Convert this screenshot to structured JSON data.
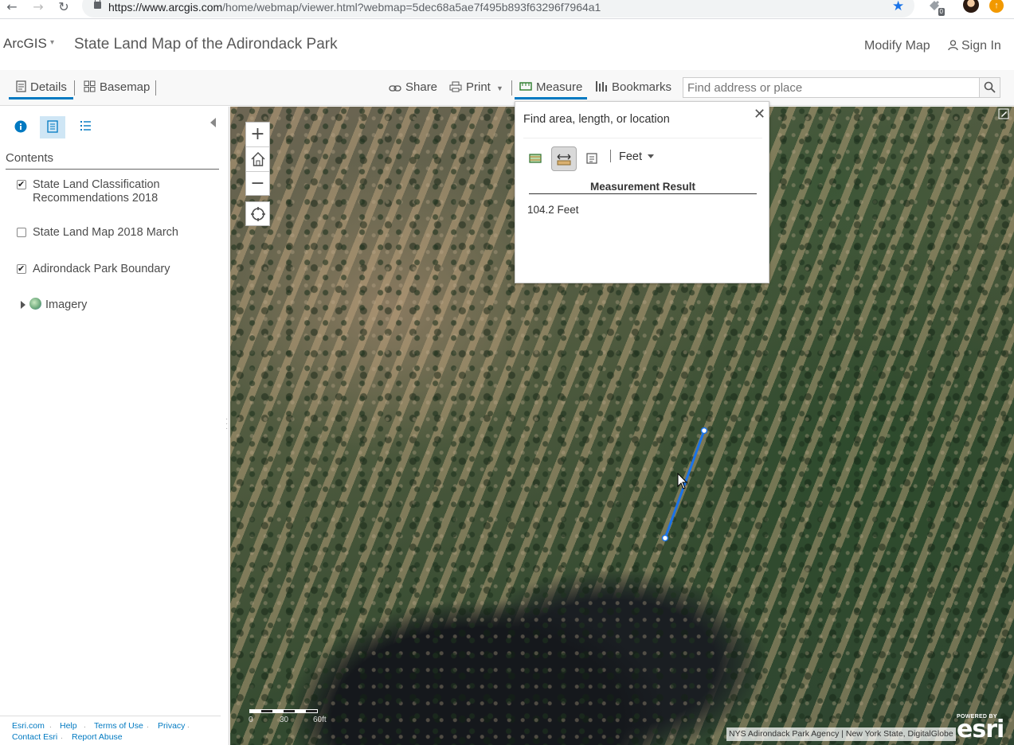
{
  "browser": {
    "url_main": "https://www.arcgis.com",
    "url_rest": "/home/webmap/viewer.html?webmap=5dec68a5ae7f495b893f63296f7964a1",
    "back_icon": "←",
    "forward_icon": "→",
    "reload_icon": "↻",
    "star_icon": "★",
    "extension_badge": "0",
    "update_icon": "↑"
  },
  "header": {
    "brand": "ArcGIS",
    "brand_caret": "▾",
    "title": "State Land Map of the Adirondack Park",
    "modify_map": "Modify Map",
    "sign_in": "Sign In"
  },
  "toolbar": {
    "details": "Details",
    "basemap": "Basemap",
    "share": "Share",
    "print": "Print",
    "measure": "Measure",
    "bookmarks": "Bookmarks",
    "search_placeholder": "Find address or place",
    "accent": "#0079c1"
  },
  "panel": {
    "contents_label": "Contents",
    "layers": [
      {
        "label": "State Land Classification Recommendations 2018",
        "checked": true
      },
      {
        "label": "State Land Map 2018 March",
        "checked": false
      },
      {
        "label": "Adirondack Park Boundary",
        "checked": true
      }
    ],
    "group_layer": "Imagery",
    "footer_links": [
      "Esri.com",
      "Help",
      "Terms of Use",
      "Privacy",
      "Contact Esri",
      "Report Abuse"
    ]
  },
  "map": {
    "zoom_in": "+",
    "zoom_out": "−",
    "scale_labels": [
      "0",
      "30",
      "60ft"
    ],
    "attribution": "NYS Adirondack Park Agency | New York State, DigitalGlobe",
    "logo_powered": "POWERED BY",
    "logo_word": "esri",
    "measure_line_color": "#1a73e8"
  },
  "measure": {
    "title": "Find area, length, or location",
    "close": "✕",
    "unit": "Feet",
    "result_header": "Measurement Result",
    "result_value": "104.2 Feet"
  }
}
